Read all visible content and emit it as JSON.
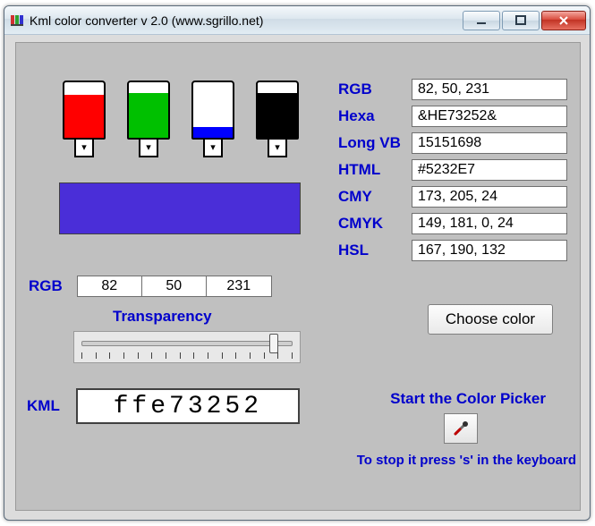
{
  "window": {
    "title": "Kml color converter v 2.0 (www.sgrillo.net)"
  },
  "bottles": {
    "r": {
      "name": "red",
      "color": "#ff0000",
      "fill_pct": 78
    },
    "g": {
      "name": "green",
      "color": "#00c000",
      "fill_pct": 80
    },
    "b": {
      "name": "blue",
      "color": "#0000ff",
      "fill_pct": 20
    },
    "k": {
      "name": "black",
      "color": "#000000",
      "fill_pct": 80
    }
  },
  "swatch_color": "#4a2ed8",
  "rgb_inputs": {
    "label": "RGB",
    "r": "82",
    "g": "50",
    "b": "231"
  },
  "transparency": {
    "label": "Transparency",
    "value_pct": 92
  },
  "kml": {
    "label": "KML",
    "value": "ffe73252"
  },
  "outputs": [
    {
      "key": "rgb",
      "label": "RGB",
      "value": "82, 50, 231"
    },
    {
      "key": "hexa",
      "label": "Hexa",
      "value": "&HE73252&"
    },
    {
      "key": "longvb",
      "label": "Long VB",
      "value": "15151698"
    },
    {
      "key": "html",
      "label": "HTML",
      "value": "#5232E7"
    },
    {
      "key": "cmy",
      "label": "CMY",
      "value": "173, 205, 24"
    },
    {
      "key": "cmyk",
      "label": "CMYK",
      "value": "149, 181, 0, 24"
    },
    {
      "key": "hsl",
      "label": "HSL",
      "value": "167, 190, 132"
    }
  ],
  "buttons": {
    "choose": "Choose color",
    "start": "Start the Color Picker",
    "stop": "To stop it press 's' in the keyboard"
  }
}
